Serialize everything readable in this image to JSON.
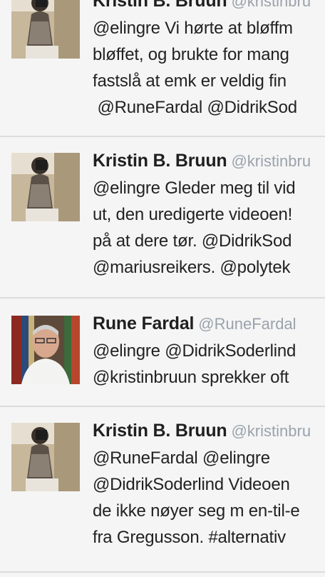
{
  "tweets": [
    {
      "name": "Kristin B. Bruun",
      "handle": "@kristinbru",
      "lines": [
        "@elingre Vi hørte at bløffm",
        "bløffet, og brukte for mang",
        "fastslå at emk er veldig fin",
        " @RuneFardal @DidrikSod"
      ],
      "avatar": "kristin-photo"
    },
    {
      "name": "Kristin B. Bruun",
      "handle": "@kristinbru",
      "lines": [
        "@elingre Gleder meg til vid",
        "ut, den uredigerte videoen!",
        "på at dere tør. @DidrikSod",
        "@mariusreikers. @polytek"
      ],
      "avatar": "kristin-photo"
    },
    {
      "name": "Rune Fardal",
      "handle": "@RuneFardal",
      "lines": [
        "@elingre @DidrikSoderlind",
        "@kristinbruun sprekker oft"
      ],
      "avatar": "rune-photo"
    },
    {
      "name": "Kristin B. Bruun",
      "handle": "@kristinbru",
      "lines": [
        "@RuneFardal @elingre",
        "@DidrikSoderlind Videoen",
        "de ikke nøyer seg m en-til-e",
        "fra Gregusson. #alternativ"
      ],
      "avatar": "kristin-photo"
    }
  ],
  "colors": {
    "background": "#f5f5f5",
    "name": "#1f1f1f",
    "handle": "#9aa3ad",
    "text": "#222222",
    "divider": "#dcdcdc"
  }
}
